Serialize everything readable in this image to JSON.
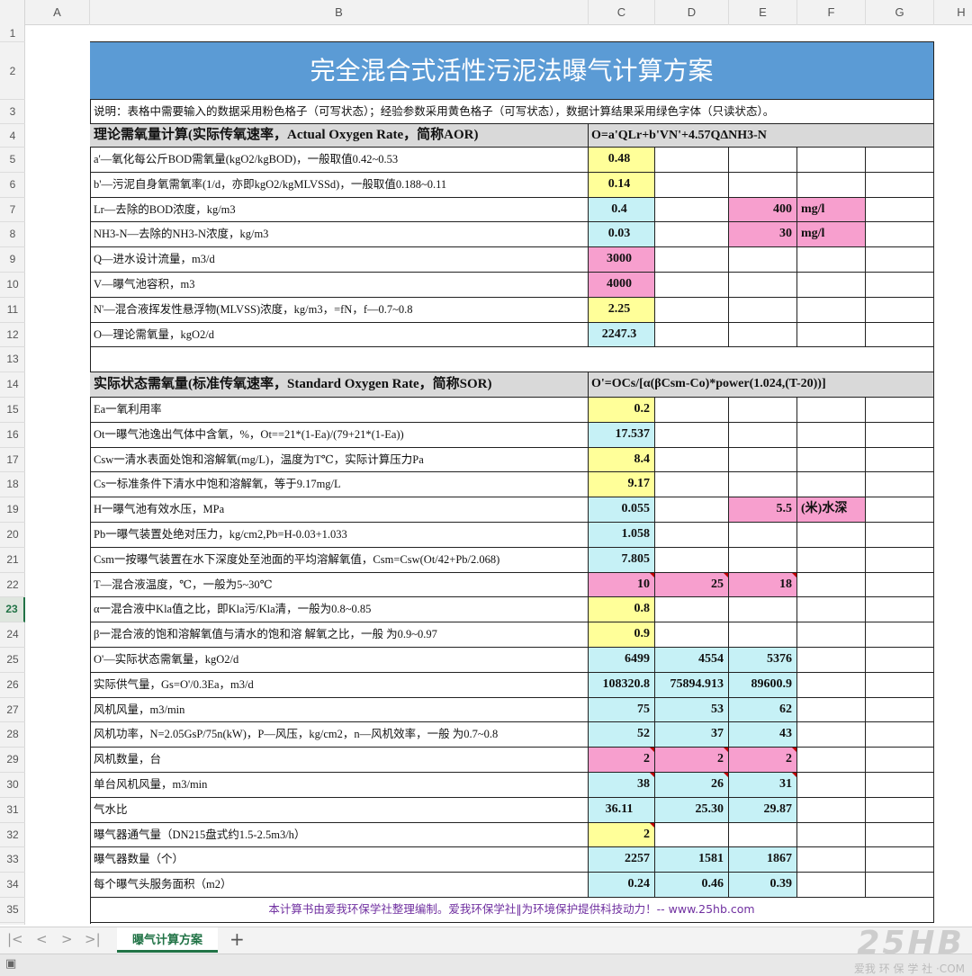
{
  "columns": [
    "A",
    "B",
    "C",
    "D",
    "E",
    "F",
    "G",
    "H"
  ],
  "rows": [
    "1",
    "2",
    "3",
    "4",
    "5",
    "6",
    "7",
    "8",
    "9",
    "10",
    "11",
    "12",
    "13",
    "14",
    "15",
    "16",
    "17",
    "18",
    "19",
    "20",
    "21",
    "22",
    "23",
    "24",
    "25",
    "26",
    "27",
    "28",
    "29",
    "30",
    "31",
    "32",
    "33",
    "34",
    "35"
  ],
  "title": "完全混合式活性污泥法曝气计算方案",
  "note": "说明：表格中需要输入的数据采用粉色格子（可写状态）；经验参数采用黄色格子（可写状态），数据计算结果采用绿色字体（只读状态）。",
  "section1": {
    "heading": "理论需氧量计算(实际传氧速率，Actual Oxygen Rate，简称AOR)",
    "formula": "O=a'QLr+b'VN'+4.57QΔNH3-N"
  },
  "section2": {
    "heading": "实际状态需氧量(标准传氧速率，Standard Oxygen Rate，简称SOR)",
    "formula": "O'=OCs/[α(βCsm-Co)*power(1.024,(T-20))]"
  },
  "r5": {
    "label": "a'—氧化每公斤BOD需氧量(kgO2/kgBOD)，一般取值0.42~0.53",
    "c": "0.48"
  },
  "r6": {
    "label": "b'—污泥自身氧需氧率(1/d，亦即kgO2/kgMLVSSd)，一般取值0.188~0.11",
    "c": "0.14"
  },
  "r7": {
    "label": "Lr—去除的BOD浓度，kg/m3",
    "c": "0.4",
    "e": "400",
    "f": "mg/l"
  },
  "r8": {
    "label": "NH3-N—去除的NH3-N浓度，kg/m3",
    "c": "0.03",
    "e": "30",
    "f": "mg/l"
  },
  "r9": {
    "label": "Q—进水设计流量，m3/d",
    "c": "3000"
  },
  "r10": {
    "label": "V—曝气池容积，m3",
    "c": "4000"
  },
  "r11": {
    "label": "N'—混合液挥发性悬浮物(MLVSS)浓度，kg/m3，=fN，f—0.7~0.8",
    "c": "2.25"
  },
  "r12": {
    "label": "O—理论需氧量，kgO2/d",
    "c": "2247.3"
  },
  "r15": {
    "label": "Ea一氧利用率",
    "c": "0.2"
  },
  "r16": {
    "label": "Ot一曝气池逸出气体中含氧，%，Ot==21*(1-Ea)/(79+21*(1-Ea))",
    "c": "17.537"
  },
  "r17": {
    "label": "Csw一清水表面处饱和溶解氧(mg/L)，温度为T℃，实际计算压力Pa",
    "c": "8.4"
  },
  "r18": {
    "label": "Cs一标准条件下清水中饱和溶解氧，等于9.17mg/L",
    "c": "9.17"
  },
  "r19": {
    "label": "H一曝气池有效水压，MPa",
    "c": "0.055",
    "e": "5.5",
    "f": "(米)水深"
  },
  "r20": {
    "label": "Pb一曝气装置处绝对压力，kg/cm2,Pb=H-0.03+1.033",
    "c": "1.058"
  },
  "r21": {
    "label": "Csm一按曝气装置在水下深度处至池面的平均溶解氧值，Csm=Csw(Ot/42+Pb/2.068)",
    "c": "7.805"
  },
  "r22": {
    "label": "T—混合液温度，℃，一般为5~30℃",
    "c": "10",
    "d": "25",
    "e": "18"
  },
  "r23": {
    "label": "α一混合液中Kla值之比，即Kla污/Kla清，一般为0.8~0.85",
    "c": "0.8"
  },
  "r24": {
    "label": "β一混合液的饱和溶解氧值与清水的饱和溶 解氧之比，一般 为0.9~0.97",
    "c": "0.9"
  },
  "r25": {
    "label": "O'—实际状态需氧量，kgO2/d",
    "c": "6499",
    "d": "4554",
    "e": "5376"
  },
  "r26": {
    "label": "实际供气量，Gs=O'/0.3Ea，m3/d",
    "c": "108320.8",
    "d": "75894.913",
    "e": "89600.9"
  },
  "r27": {
    "label": "风机风量，m3/min",
    "c": "75",
    "d": "53",
    "e": "62"
  },
  "r28": {
    "label": "风机功率，N=2.05GsP/75n(kW)，P—风压，kg/cm2，n—风机效率，一般 为0.7~0.8",
    "c": "52",
    "d": "37",
    "e": "43"
  },
  "r29": {
    "label": "风机数量，台",
    "c": "2",
    "d": "2",
    "e": "2"
  },
  "r30": {
    "label": "单台风机风量，m3/min",
    "c": "38",
    "d": "26",
    "e": "31"
  },
  "r31": {
    "label": "气水比",
    "c": "36.11",
    "d": "25.30",
    "e": "29.87"
  },
  "r32": {
    "label": "曝气器通气量（DN215盘式约1.5-2.5m3/h）",
    "c": "2"
  },
  "r33": {
    "label": "曝气器数量（个）",
    "c": "2257",
    "d": "1581",
    "e": "1867"
  },
  "r34": {
    "label": "每个曝气头服务面积（m2）",
    "c": "0.24",
    "d": "0.46",
    "e": "0.39"
  },
  "footer": "本计算书由爱我环保学社整理编制。爱我环保学社‖为环境保护提供科技动力！-- www.25hb.com",
  "sheet_tab": "曝气计算方案",
  "watermark": {
    "logo": "25HB",
    "text": "爱我 环 保 学 社 ·COM"
  },
  "colors": {
    "pink": "#f79fce",
    "yellow": "#ffff99",
    "cyan": "#c6f1f6",
    "title_bg": "#5b9bd5",
    "accent": "#217346"
  }
}
